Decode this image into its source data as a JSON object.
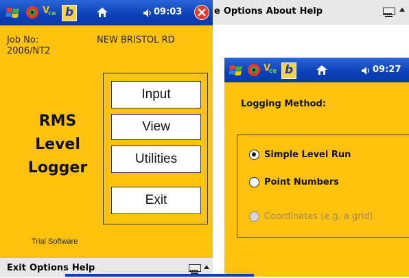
{
  "screen1": {
    "time": "09:03",
    "job_label": "Job No:",
    "job_number": "2006/NT2",
    "job_name": "NEW BRISTOL RD",
    "app_title": [
      "RMS",
      "Level",
      "Logger"
    ],
    "buttons": {
      "input": "Input",
      "view": "View",
      "utilities": "Utilities",
      "exit": "Exit"
    },
    "footer": "Trial Software",
    "menu": [
      "Exit",
      "Options",
      "Help"
    ]
  },
  "back_window": {
    "menu": [
      "e",
      "Options",
      "About",
      "Help"
    ]
  },
  "screen2": {
    "time": "09:27",
    "heading": "Logging Method:",
    "options": [
      {
        "label": "Simple Level Run",
        "selected": true,
        "enabled": true
      },
      {
        "label": "Point Numbers",
        "selected": false,
        "enabled": true
      },
      {
        "label": "Coordinates (e.g. a grid)",
        "selected": false,
        "enabled": false
      }
    ]
  },
  "colors": {
    "accent": "#ffc20e",
    "titlebar": "#0b3fb6",
    "disabled_text": "#9a8a5a"
  }
}
